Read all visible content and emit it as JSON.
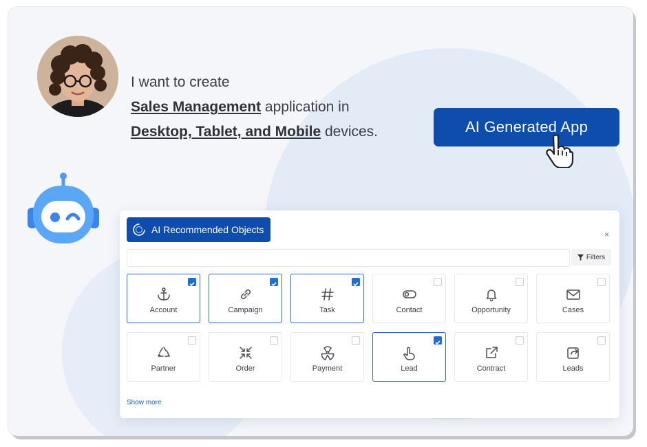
{
  "prompt": {
    "line1": "I want to create",
    "line2_highlight": "Sales Management",
    "line2_rest": " application in",
    "line3_highlight": "Desktop, Tablet, and Mobile",
    "line3_rest": " devices."
  },
  "cta": {
    "label": "AI Generated App"
  },
  "panel": {
    "title": "AI Recommended Objects",
    "close": "×",
    "search_placeholder": "",
    "filters_label": "Filters",
    "show_more": "Show more",
    "tiles": [
      {
        "label": "Account",
        "icon": "anchor-icon",
        "checked": true
      },
      {
        "label": "Campaign",
        "icon": "link-icon",
        "checked": true
      },
      {
        "label": "Task",
        "icon": "hash-icon",
        "checked": true
      },
      {
        "label": "Contact",
        "icon": "toggle-icon",
        "checked": false
      },
      {
        "label": "Opportunity",
        "icon": "bell-icon",
        "checked": false
      },
      {
        "label": "Cases",
        "icon": "mail-icon",
        "checked": false
      },
      {
        "label": "Partner",
        "icon": "recycle-icon",
        "checked": false
      },
      {
        "label": "Order",
        "icon": "shrink-icon",
        "checked": false
      },
      {
        "label": "Payment",
        "icon": "radiation-icon",
        "checked": false
      },
      {
        "label": "Lead",
        "icon": "pointer-icon",
        "checked": true
      },
      {
        "label": "Contract",
        "icon": "external-link-icon",
        "checked": false
      },
      {
        "label": "Leads",
        "icon": "share-box-icon",
        "checked": false
      }
    ]
  },
  "colors": {
    "brand_blue": "#0e4dab",
    "check_blue": "#1f6fd1",
    "blob": "#e3ebf7"
  }
}
